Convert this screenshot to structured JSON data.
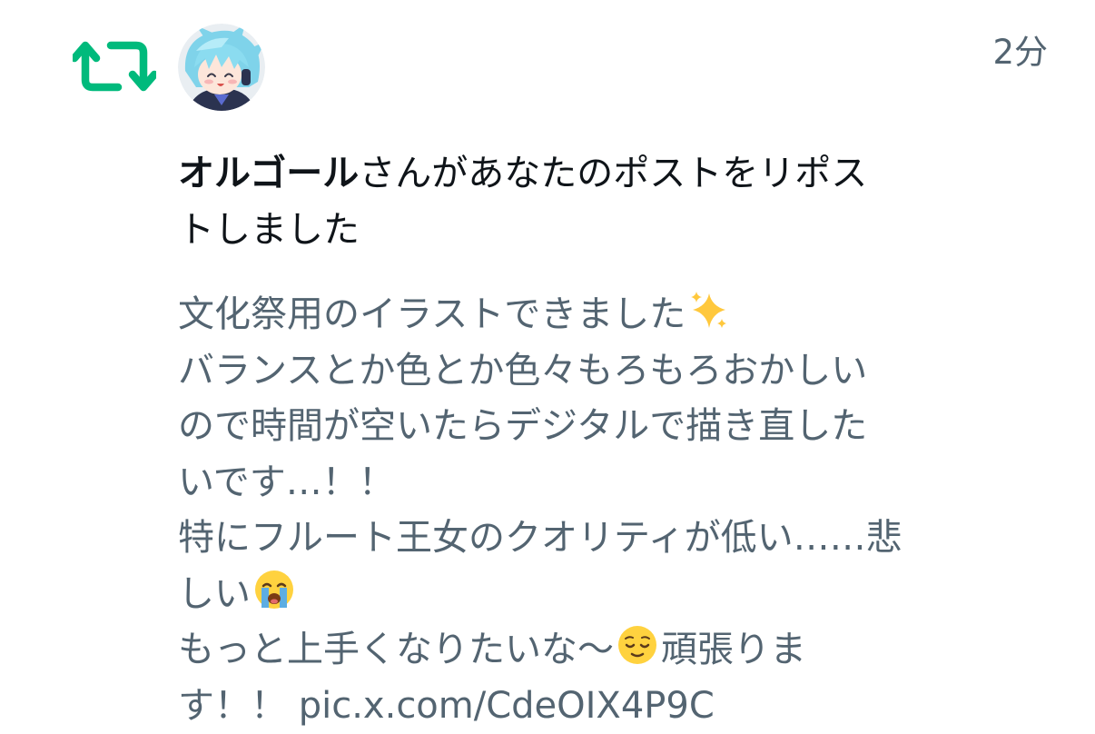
{
  "notification": {
    "timestamp": "2分",
    "user_name": "オルゴール",
    "action_text": "さんがあなたのポストをリポストしました",
    "action_line1": "さんがあなたのポストをリポス",
    "action_line2": "トしました",
    "icon": "repost-icon",
    "avatar_icon": "anime-avatar",
    "accent_color": "#00ba7c"
  },
  "post": {
    "lines": [
      "文化祭用のイラストできました",
      "バランスとか色とか色々もろもろおかしい",
      "ので時間が空いたらデジタルで描き直した",
      "いです…！！",
      "特にフルート王女のクオリティが低い……悲",
      "しい",
      "もっと上手くなりたいな〜",
      "頑張りま",
      "す！！ ",
      "pic.x.com/CdeOIX4P9C"
    ],
    "emojis": [
      "sparkles-emoji",
      "crying-face-emoji",
      "relieved-face-emoji"
    ]
  }
}
